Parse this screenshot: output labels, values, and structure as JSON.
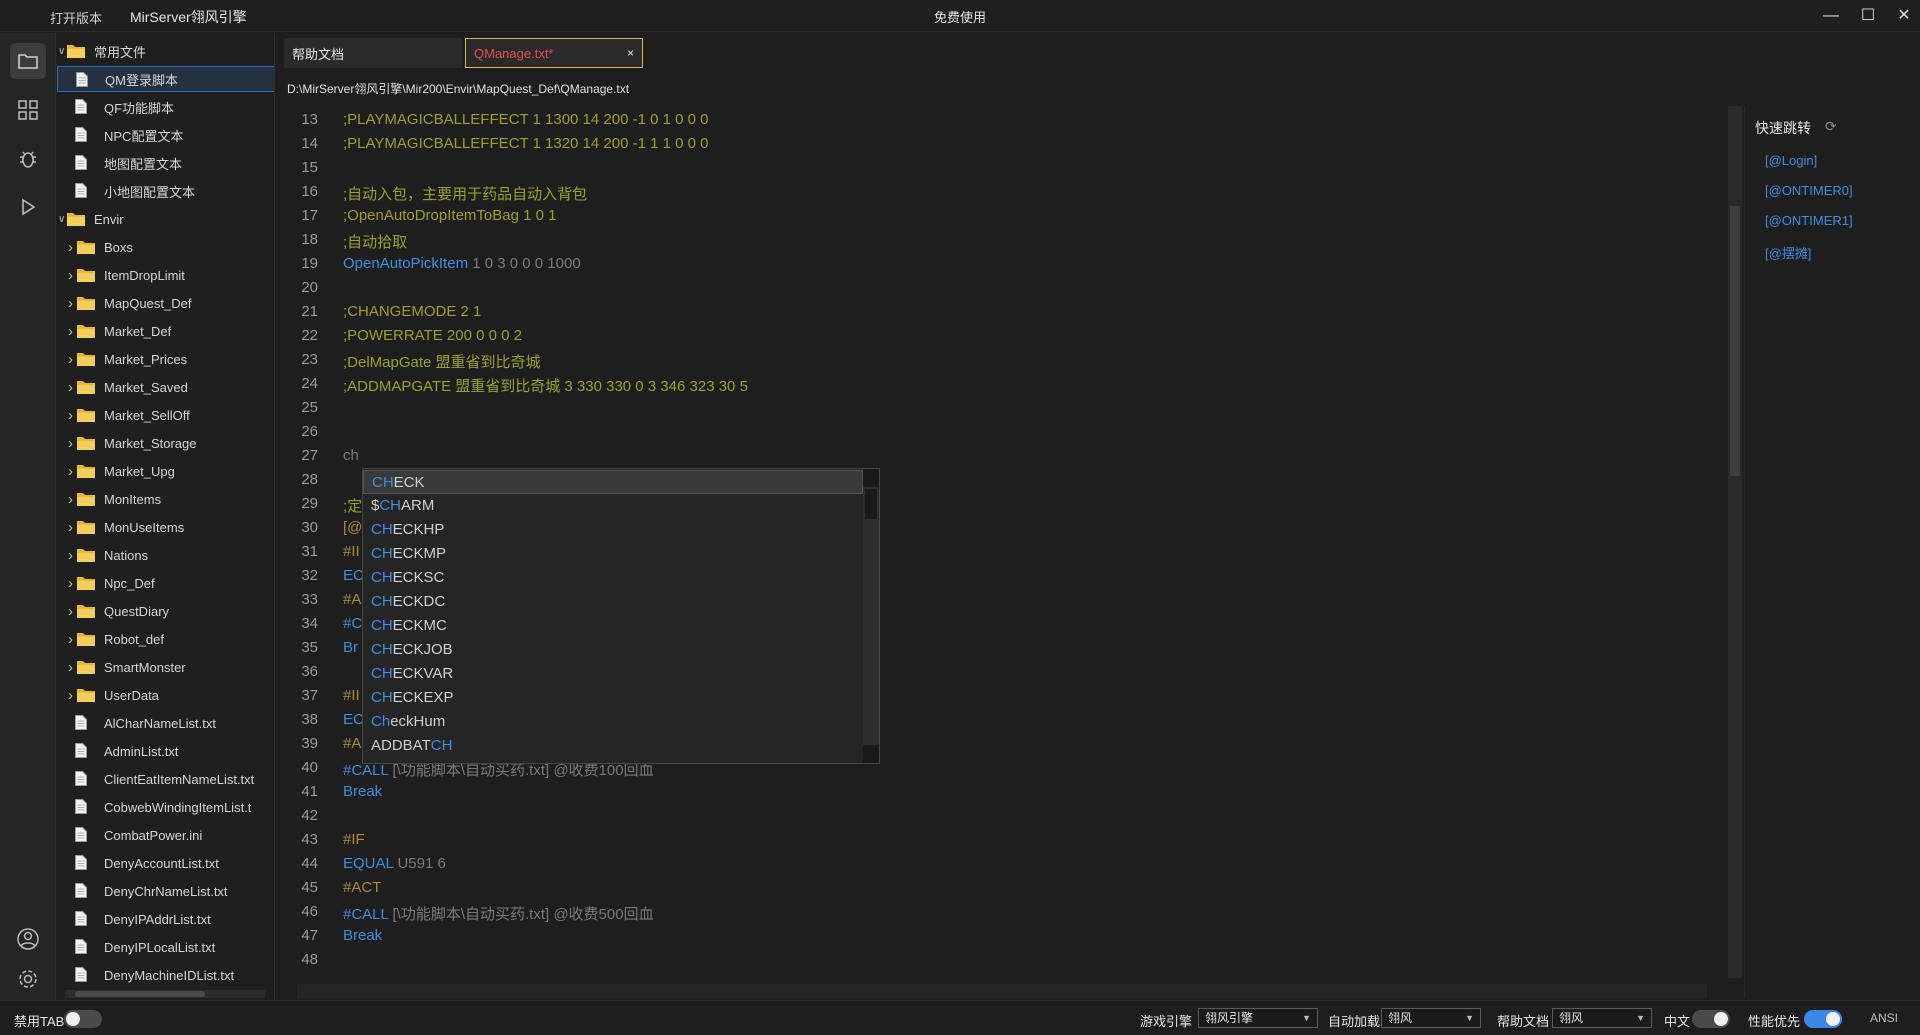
{
  "titlebar": {
    "open_version": "打开版本",
    "app_title": "MirServer翎风引擎",
    "center_title": "免费使用",
    "minimize": "—",
    "maximize": "☐",
    "close": "✕"
  },
  "explorer": {
    "items": [
      {
        "label": "常用文件",
        "type": "folder",
        "expanded": true,
        "depth": 0
      },
      {
        "label": "QM登录脚本",
        "type": "file",
        "depth": 1,
        "selected": true
      },
      {
        "label": "QF功能脚本",
        "type": "file",
        "depth": 1
      },
      {
        "label": "NPC配置文本",
        "type": "file",
        "depth": 1
      },
      {
        "label": "地图配置文本",
        "type": "file",
        "depth": 1
      },
      {
        "label": "小地图配置文本",
        "type": "file",
        "depth": 1
      },
      {
        "label": "Envir",
        "type": "folder",
        "expanded": true,
        "depth": 0
      },
      {
        "label": "Boxs",
        "type": "folder",
        "depth": 1
      },
      {
        "label": "ItemDropLimit",
        "type": "folder",
        "depth": 1
      },
      {
        "label": "MapQuest_Def",
        "type": "folder",
        "depth": 1
      },
      {
        "label": "Market_Def",
        "type": "folder",
        "depth": 1
      },
      {
        "label": "Market_Prices",
        "type": "folder",
        "depth": 1
      },
      {
        "label": "Market_Saved",
        "type": "folder",
        "depth": 1
      },
      {
        "label": "Market_SellOff",
        "type": "folder",
        "depth": 1
      },
      {
        "label": "Market_Storage",
        "type": "folder",
        "depth": 1
      },
      {
        "label": "Market_Upg",
        "type": "folder",
        "depth": 1
      },
      {
        "label": "MonItems",
        "type": "folder",
        "depth": 1
      },
      {
        "label": "MonUseItems",
        "type": "folder",
        "depth": 1
      },
      {
        "label": "Nations",
        "type": "folder",
        "depth": 1
      },
      {
        "label": "Npc_Def",
        "type": "folder",
        "depth": 1
      },
      {
        "label": "QuestDiary",
        "type": "folder",
        "depth": 1
      },
      {
        "label": "Robot_def",
        "type": "folder",
        "depth": 1
      },
      {
        "label": "SmartMonster",
        "type": "folder",
        "depth": 1
      },
      {
        "label": "UserData",
        "type": "folder",
        "depth": 1
      },
      {
        "label": "AlCharNameList.txt",
        "type": "file",
        "depth": 1
      },
      {
        "label": "AdminList.txt",
        "type": "file",
        "depth": 1
      },
      {
        "label": "ClientEatItemNameList.txt",
        "type": "file",
        "depth": 1
      },
      {
        "label": "CobwebWindingItemList.t",
        "type": "file",
        "depth": 1
      },
      {
        "label": "CombatPower.ini",
        "type": "file",
        "depth": 1
      },
      {
        "label": "DenyAccountList.txt",
        "type": "file",
        "depth": 1
      },
      {
        "label": "DenyChrNameList.txt",
        "type": "file",
        "depth": 1
      },
      {
        "label": "DenyIPAddrList.txt",
        "type": "file",
        "depth": 1
      },
      {
        "label": "DenyIPLocalList.txt",
        "type": "file",
        "depth": 1
      },
      {
        "label": "DenyMachineIDList.txt",
        "type": "file",
        "depth": 1
      }
    ]
  },
  "tabs": [
    {
      "label": "帮助文档",
      "active": false
    },
    {
      "label": "QManage.txt*",
      "active": true,
      "close": "×"
    }
  ],
  "editor": {
    "path": "D:\\MirServer翎风引擎\\Mir200\\Envir\\MapQuest_Def\\QManage.txt",
    "lines": [
      {
        "n": "13",
        "parts": [
          {
            "t": ";PLAYMAGICBALLEFFECT 1 1300 14 200 -1 0 1 0 0 0",
            "c": "cm"
          }
        ]
      },
      {
        "n": "14",
        "parts": [
          {
            "t": ";PLAYMAGICBALLEFFECT 1 1320 14 200 -1 1 1 0 0 0",
            "c": "cm"
          }
        ]
      },
      {
        "n": "15",
        "parts": []
      },
      {
        "n": "16",
        "parts": [
          {
            "t": ";自动入包，主要用于药品自动入背包",
            "c": "cm"
          }
        ]
      },
      {
        "n": "17",
        "parts": [
          {
            "t": ";OpenAutoDropItemToBag 1 0 1",
            "c": "cm"
          }
        ]
      },
      {
        "n": "18",
        "parts": [
          {
            "t": ";自动拾取",
            "c": "cm"
          }
        ]
      },
      {
        "n": "19",
        "parts": [
          {
            "t": "OpenAutoPickItem",
            "c": "kw"
          },
          {
            "t": " 1 0 3 0 0 0 1000",
            "c": "arg"
          }
        ]
      },
      {
        "n": "20",
        "parts": []
      },
      {
        "n": "21",
        "parts": [
          {
            "t": ";CHANGEMODE 2 1",
            "c": "cm"
          }
        ]
      },
      {
        "n": "22",
        "parts": [
          {
            "t": ";POWERRATE 200 0 0 0 2",
            "c": "cm"
          }
        ]
      },
      {
        "n": "23",
        "parts": [
          {
            "t": ";DelMapGate 盟重省到比奇城",
            "c": "cm"
          }
        ]
      },
      {
        "n": "24",
        "parts": [
          {
            "t": ";ADDMAPGATE 盟重省到比奇城 3 330 330 0 3 346 323 30 5",
            "c": "cm"
          }
        ]
      },
      {
        "n": "25",
        "parts": []
      },
      {
        "n": "26",
        "parts": []
      },
      {
        "n": "27",
        "parts": [
          {
            "t": "ch",
            "c": "arg"
          }
        ]
      },
      {
        "n": "28",
        "parts": []
      },
      {
        "n": "29",
        "parts": [
          {
            "t": ";定",
            "c": "cm"
          }
        ]
      },
      {
        "n": "30",
        "parts": [
          {
            "t": "[@",
            "c": "cm2"
          }
        ]
      },
      {
        "n": "31",
        "parts": [
          {
            "t": "#II",
            "c": "cm2"
          }
        ]
      },
      {
        "n": "32",
        "parts": [
          {
            "t": "EC",
            "c": "kw"
          }
        ]
      },
      {
        "n": "33",
        "parts": [
          {
            "t": "#A",
            "c": "cm2"
          }
        ]
      },
      {
        "n": "34",
        "parts": [
          {
            "t": "#C",
            "c": "kw"
          }
        ]
      },
      {
        "n": "35",
        "parts": [
          {
            "t": "Br",
            "c": "kw"
          }
        ]
      },
      {
        "n": "36",
        "parts": []
      },
      {
        "n": "37",
        "parts": [
          {
            "t": "#II",
            "c": "cm2"
          }
        ]
      },
      {
        "n": "38",
        "parts": [
          {
            "t": "EC",
            "c": "kw"
          }
        ]
      },
      {
        "n": "39",
        "parts": [
          {
            "t": "#A",
            "c": "cm2"
          }
        ]
      },
      {
        "n": "40",
        "parts": [
          {
            "t": "#CALL",
            "c": "kw"
          },
          {
            "t": " [\\功能脚本\\自动买药.txt] @收费100回血",
            "c": "arg"
          }
        ]
      },
      {
        "n": "41",
        "parts": [
          {
            "t": "Break",
            "c": "kw"
          }
        ]
      },
      {
        "n": "42",
        "parts": []
      },
      {
        "n": "43",
        "parts": [
          {
            "t": "#IF",
            "c": "cm2"
          }
        ]
      },
      {
        "n": "44",
        "parts": [
          {
            "t": "EQUAL",
            "c": "kw"
          },
          {
            "t": " U591 6",
            "c": "arg"
          }
        ]
      },
      {
        "n": "45",
        "parts": [
          {
            "t": "#ACT",
            "c": "cm2"
          }
        ]
      },
      {
        "n": "46",
        "parts": [
          {
            "t": "#CALL",
            "c": "kw"
          },
          {
            "t": " [\\功能脚本\\自动买药.txt] @收费500回血",
            "c": "arg"
          }
        ]
      },
      {
        "n": "47",
        "parts": [
          {
            "t": "Break",
            "c": "kw"
          }
        ]
      },
      {
        "n": "48",
        "parts": []
      }
    ]
  },
  "autocomplete": {
    "items": [
      {
        "pre": "",
        "match": "CH",
        "post": "ECK",
        "selected": true
      },
      {
        "pre": "$",
        "match": "CH",
        "post": "ARM"
      },
      {
        "pre": "",
        "match": "CH",
        "post": "ECKHP"
      },
      {
        "pre": "",
        "match": "CH",
        "post": "ECKMP"
      },
      {
        "pre": "",
        "match": "CH",
        "post": "ECKSC"
      },
      {
        "pre": "",
        "match": "CH",
        "post": "ECKDC"
      },
      {
        "pre": "",
        "match": "CH",
        "post": "ECKMC"
      },
      {
        "pre": "",
        "match": "CH",
        "post": "ECKJOB"
      },
      {
        "pre": "",
        "match": "CH",
        "post": "ECKVAR"
      },
      {
        "pre": "",
        "match": "CH",
        "post": "ECKEXP"
      },
      {
        "pre": "",
        "match": "Ch",
        "post": "eckHum"
      },
      {
        "pre": "ADDBAT",
        "match": "CH",
        "post": ""
      }
    ]
  },
  "outline": {
    "title": "快速跳转",
    "refresh_icon": "⟳",
    "items": [
      "[@Login]",
      "[@ONTIMER0]",
      "[@ONTIMER1]",
      "[@摆摊]"
    ]
  },
  "statusbar": {
    "disable_tab_label": "禁用TAB",
    "disable_tab_on": false,
    "game_engine_label": "游戏引擎",
    "game_engine_value": "翎风引擎",
    "auto_load_label": "自动加载",
    "auto_load_value": "翎风",
    "help_doc_label": "帮助文档",
    "help_doc_value": "翎风",
    "chinese_label": "中文",
    "chinese_on": false,
    "perf_label": "性能优先",
    "perf_on": true,
    "encoding": "ANSI"
  }
}
